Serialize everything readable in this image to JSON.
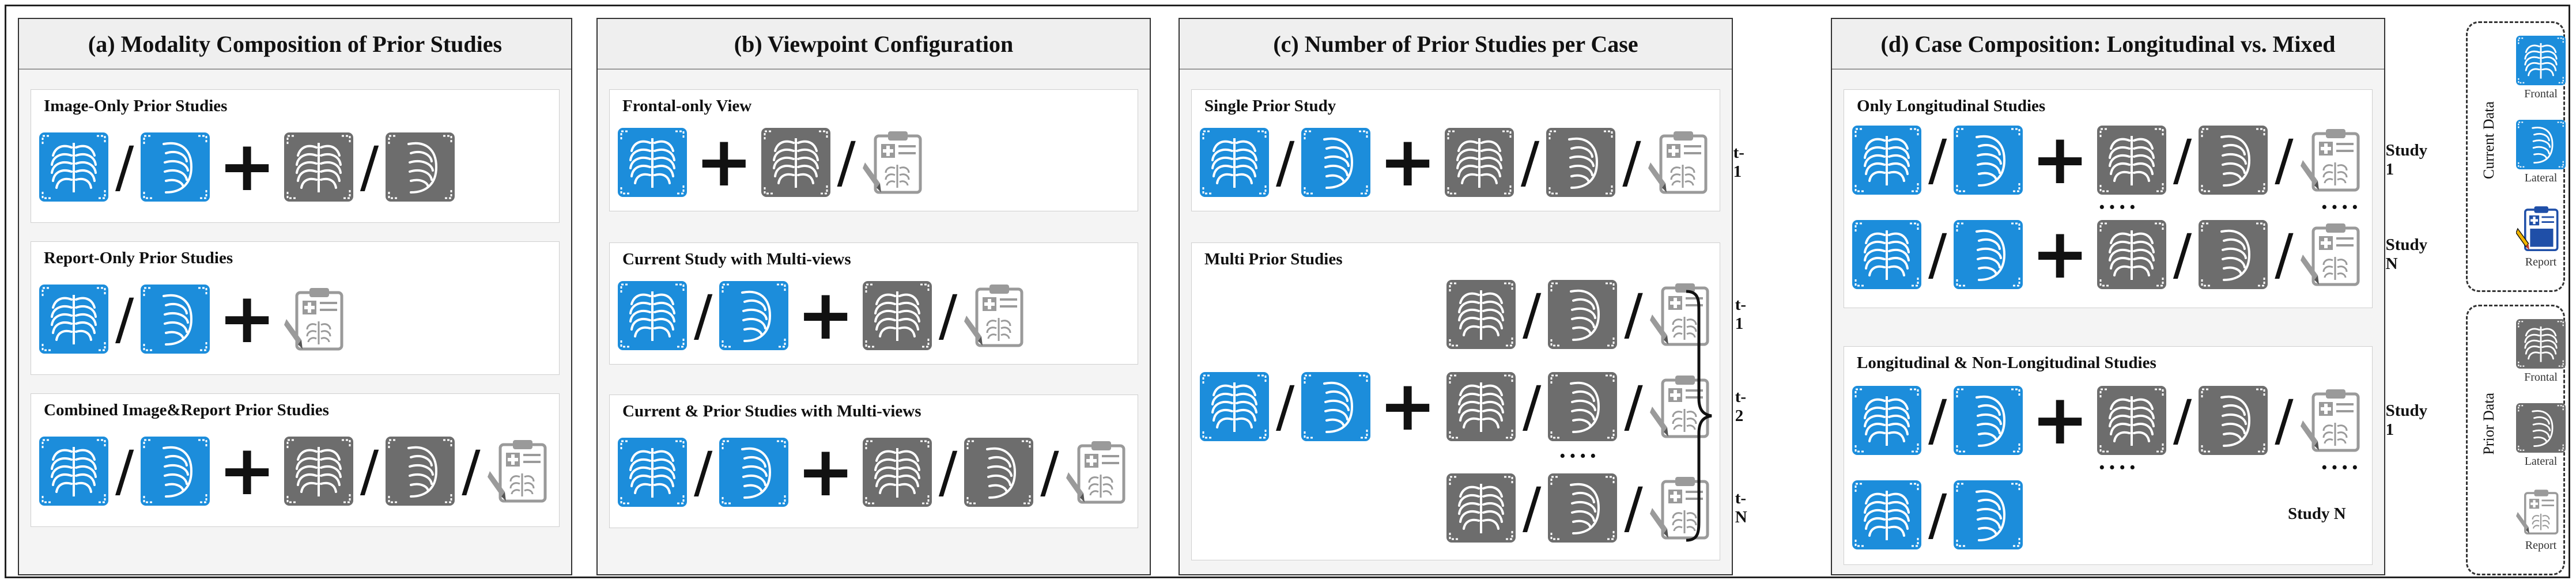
{
  "panels": {
    "a": {
      "title": "(a) Modality Composition of Prior Studies",
      "boxes": [
        {
          "title": "Image-Only Prior Studies"
        },
        {
          "title": "Report-Only Prior Studies"
        },
        {
          "title": "Combined Image&Report Prior Studies"
        }
      ]
    },
    "b": {
      "title": "(b) Viewpoint Configuration",
      "boxes": [
        {
          "title": "Frontal-only View"
        },
        {
          "title": "Current Study with Multi-views"
        },
        {
          "title": "Current & Prior Studies with Multi-views"
        }
      ]
    },
    "c": {
      "title": "(c) Number of Prior Studies per Case",
      "boxes": [
        {
          "title": "Single Prior Study"
        },
        {
          "title": "Multi Prior Studies"
        }
      ],
      "labels": {
        "t1": "t-1",
        "t2": "t-2",
        "tN": "t-N",
        "dots": "····"
      }
    },
    "d": {
      "title": "(d) Case Composition: Longitudinal vs. Mixed",
      "boxes": [
        {
          "title": "Only Longitudinal Studies"
        },
        {
          "title": "Longitudinal & Non-Longitudinal Studies"
        }
      ],
      "labels": {
        "study1": "Study 1",
        "studyN": "Study N",
        "dots": "····"
      }
    }
  },
  "legend": {
    "current": {
      "title": "Current Data",
      "items": [
        "Frontal",
        "Lateral",
        "Report"
      ]
    },
    "prior": {
      "title": "Prior Data",
      "items": [
        "Frontal",
        "Lateral",
        "Report"
      ]
    }
  },
  "symbols": {
    "slash": "/",
    "plus": "+"
  },
  "colors": {
    "current_blue": "#1c8ddb",
    "prior_gray": "#6d6d6d",
    "report_gray": "#9a9a9a",
    "report_blue": "#1f4fa8"
  },
  "icons": [
    "frontal-xray-icon",
    "lateral-xray-icon",
    "report-clipboard-icon"
  ]
}
